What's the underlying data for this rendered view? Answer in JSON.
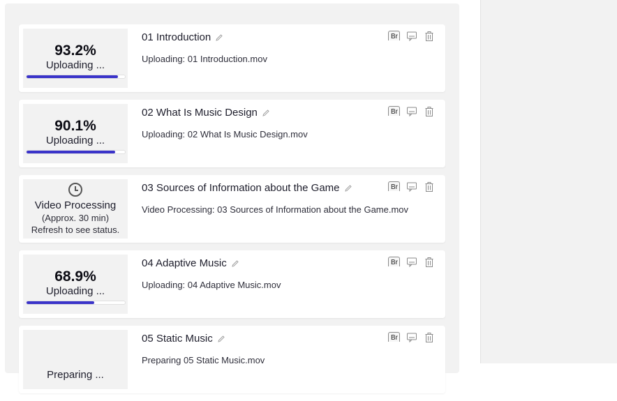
{
  "colors": {
    "progress_fill": "#3a33c9",
    "panel_bg": "#f2f2f2"
  },
  "uploads": [
    {
      "title": "01 Introduction",
      "subtitle": "Uploading: 01 Introduction.mov",
      "state": "uploading",
      "percent_label": "93.2%",
      "progress": 0.932,
      "status_label": "Uploading ...",
      "image_button_alt": "Br",
      "icons": [
        "edit-pencil-icon",
        "broken-image-button",
        "comment-icon",
        "trash-icon"
      ]
    },
    {
      "title": "02 What Is Music Design",
      "subtitle": "Uploading: 02 What Is Music Design.mov",
      "state": "uploading",
      "percent_label": "90.1%",
      "progress": 0.901,
      "status_label": "Uploading ...",
      "image_button_alt": "Br",
      "icons": [
        "edit-pencil-icon",
        "broken-image-button",
        "comment-icon",
        "trash-icon"
      ]
    },
    {
      "title": "03 Sources of Information about the Game",
      "subtitle": "Video Processing: 03 Sources of Information about the Game.mov",
      "state": "processing",
      "status_label": "Video Processing",
      "status_note": "(Approx. 30 min)",
      "status_hint": "Refresh to see status.",
      "image_button_alt": "Br",
      "icons": [
        "clock-icon",
        "edit-pencil-icon",
        "broken-image-button",
        "comment-icon",
        "trash-icon"
      ]
    },
    {
      "title": "04 Adaptive Music",
      "subtitle": "Uploading: 04 Adaptive Music.mov",
      "state": "uploading",
      "percent_label": "68.9%",
      "progress": 0.689,
      "status_label": "Uploading ...",
      "image_button_alt": "Br",
      "icons": [
        "edit-pencil-icon",
        "broken-image-button",
        "comment-icon",
        "trash-icon"
      ]
    },
    {
      "title": "05 Static Music",
      "subtitle": "Preparing 05 Static Music.mov",
      "state": "preparing",
      "status_label": "Preparing ...",
      "image_button_alt": "Br",
      "icons": [
        "edit-pencil-icon",
        "broken-image-button",
        "comment-icon",
        "trash-icon"
      ]
    }
  ]
}
